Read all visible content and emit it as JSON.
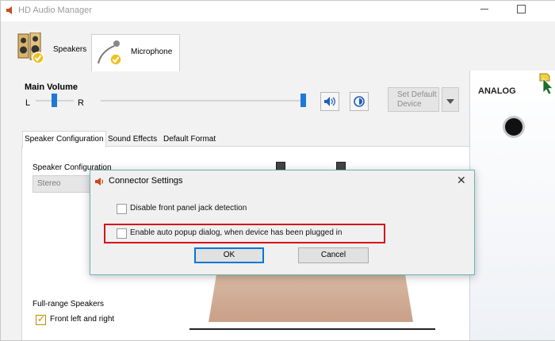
{
  "window": {
    "title": "HD Audio Manager"
  },
  "device_tabs": [
    {
      "label": "Speakers",
      "icon": "speakers-icon",
      "active": true
    },
    {
      "label": "Microphone",
      "icon": "microphone-icon",
      "active": false
    }
  ],
  "main_volume": {
    "label": "Main Volume",
    "left_label": "L",
    "right_label": "R",
    "balance_fraction": 0.5,
    "volume_fraction": 1.0
  },
  "buttons": {
    "mute_icon": "speaker-volume-icon",
    "effects_icon": "audio-effects-icon",
    "set_default": "Set Default\nDevice"
  },
  "analog_panel": {
    "label": "ANALOG"
  },
  "sub_tabs": [
    "Speaker Configuration",
    "Sound Effects",
    "Default Format"
  ],
  "speaker_config": {
    "group_label": "Speaker Configuration",
    "selected": "Stereo"
  },
  "full_range": {
    "group_label": "Full-range Speakers",
    "option": "Front left and right",
    "checked": true
  },
  "dialog": {
    "title": "Connector Settings",
    "options": [
      {
        "label": "Disable front panel jack detection",
        "checked": false
      },
      {
        "label": "Enable auto popup dialog, when device has been plugged in",
        "checked": false
      }
    ],
    "ok": "OK",
    "cancel": "Cancel"
  },
  "colors": {
    "accent": "#1e78d6",
    "highlight": "#d4141d",
    "dialog_border": "#69b3b5"
  }
}
